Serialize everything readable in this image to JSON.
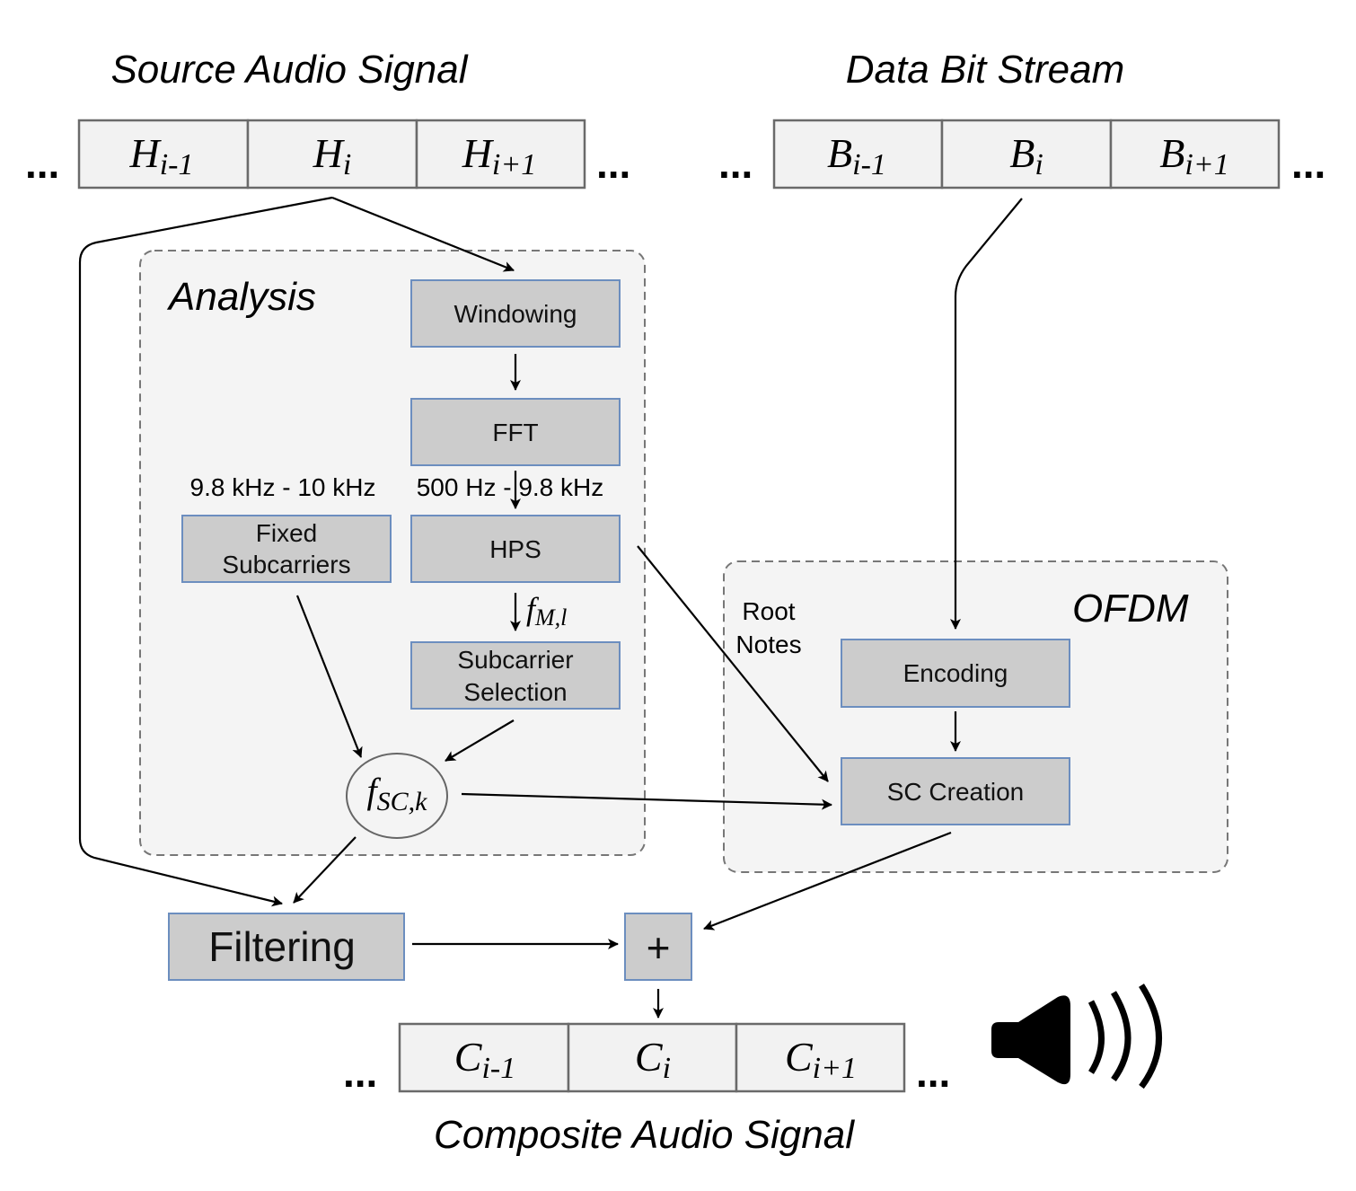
{
  "titles": {
    "source": "Source Audio Signal",
    "data": "Data Bit Stream",
    "composite": "Composite Audio Signal"
  },
  "ellipsis": "...",
  "source_frames": [
    {
      "base": "H",
      "sub": "i-1"
    },
    {
      "base": "H",
      "sub": "i"
    },
    {
      "base": "H",
      "sub": "i+1"
    }
  ],
  "data_frames": [
    {
      "base": "B",
      "sub": "i-1"
    },
    {
      "base": "B",
      "sub": "i"
    },
    {
      "base": "B",
      "sub": "i+1"
    }
  ],
  "composite_frames": [
    {
      "base": "C",
      "sub": "i-1"
    },
    {
      "base": "C",
      "sub": "i"
    },
    {
      "base": "C",
      "sub": "i+1"
    }
  ],
  "analysis": {
    "title": "Analysis",
    "windowing": "Windowing",
    "fft": "FFT",
    "range_fixed": "9.8 kHz - 10 kHz",
    "range_hps": "500 Hz - 9.8 kHz",
    "fixed_subcarriers": [
      "Fixed",
      "Subcarriers"
    ],
    "hps": "HPS",
    "f_ml": {
      "base": "f",
      "sub": "M,l"
    },
    "subcarrier_selection": [
      "Subcarrier",
      "Selection"
    ],
    "f_sck": {
      "base": "f",
      "sub": "SC,k"
    }
  },
  "ofdm": {
    "title": "OFDM",
    "root_notes": [
      "Root",
      "Notes"
    ],
    "encoding": "Encoding",
    "sc_creation": "SC Creation"
  },
  "filtering": "Filtering",
  "adder": "+",
  "icons": {
    "speaker": "speaker-icon"
  },
  "colors": {
    "block_fill": "#cccccc",
    "block_border": "#6c8ebf",
    "cell_fill": "#f2f2f2",
    "group_fill": "#f4f4f4",
    "group_border": "#777777"
  }
}
